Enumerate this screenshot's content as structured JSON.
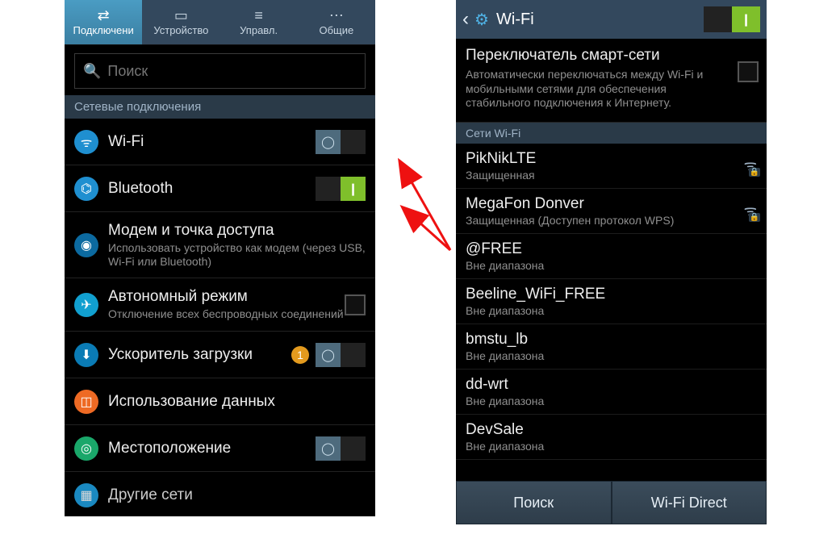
{
  "left": {
    "tabs": [
      {
        "label": "Подключени",
        "icon": "⇄",
        "active": true
      },
      {
        "label": "Устройство",
        "icon": "▭",
        "active": false
      },
      {
        "label": "Управл.",
        "icon": "≡",
        "active": false
      },
      {
        "label": "Общие",
        "icon": "⋯",
        "active": false
      }
    ],
    "search": {
      "placeholder": "Поиск"
    },
    "section": "Сетевые подключения",
    "rows": {
      "wifi": {
        "title": "Wi-Fi",
        "toggle": "off",
        "icon": "ic-wifi",
        "glyph": "ᯤ"
      },
      "bt": {
        "title": "Bluetooth",
        "toggle": "on",
        "icon": "ic-bt",
        "glyph": "⌬"
      },
      "modem": {
        "title": "Модем и точка доступа",
        "subtitle": "Использовать устройство как модем (через USB, Wi-Fi или Bluetooth)",
        "icon": "ic-modem",
        "glyph": "◉"
      },
      "plane": {
        "title": "Автономный режим",
        "subtitle": "Отключение всех беспроводных соединений",
        "checkbox": true,
        "icon": "ic-plane",
        "glyph": "✈"
      },
      "boost": {
        "title": "Ускоритель загрузки",
        "toggle": "off",
        "icon": "ic-boost",
        "glyph": "⬇",
        "new": true
      },
      "data": {
        "title": "Использование данных",
        "icon": "ic-data",
        "glyph": "◫"
      },
      "loc": {
        "title": "Местоположение",
        "toggle": "off",
        "icon": "ic-loc",
        "glyph": "◎"
      },
      "other": {
        "title": "Другие сети",
        "icon": "ic-other",
        "glyph": "▦"
      }
    }
  },
  "right": {
    "header": {
      "title": "Wi-Fi",
      "toggle": "on"
    },
    "smart": {
      "title": "Переключатель смарт-сети",
      "subtitle": "Автоматически переключаться между Wi-Fi и мобильными сетями для обеспечения стабильного подключения к Интернету."
    },
    "net_section": "Сети Wi-Fi",
    "networks": [
      {
        "name": "PikNikLTE",
        "status": "Защищенная",
        "signal": true,
        "locked": true
      },
      {
        "name": "MegaFon Donver",
        "status": "Защищенная (Доступен протокол WPS)",
        "signal": true,
        "locked": true
      },
      {
        "name": "@FREE",
        "status": "Вне диапазона",
        "signal": false
      },
      {
        "name": "Beeline_WiFi_FREE",
        "status": "Вне диапазона",
        "signal": false
      },
      {
        "name": "bmstu_lb",
        "status": "Вне диапазона",
        "signal": false
      },
      {
        "name": "dd-wrt",
        "status": "Вне диапазона",
        "signal": false
      },
      {
        "name": "DevSale",
        "status": "Вне диапазона",
        "signal": false
      }
    ],
    "buttons": {
      "search": "Поиск",
      "direct": "Wi-Fi Direct"
    }
  }
}
